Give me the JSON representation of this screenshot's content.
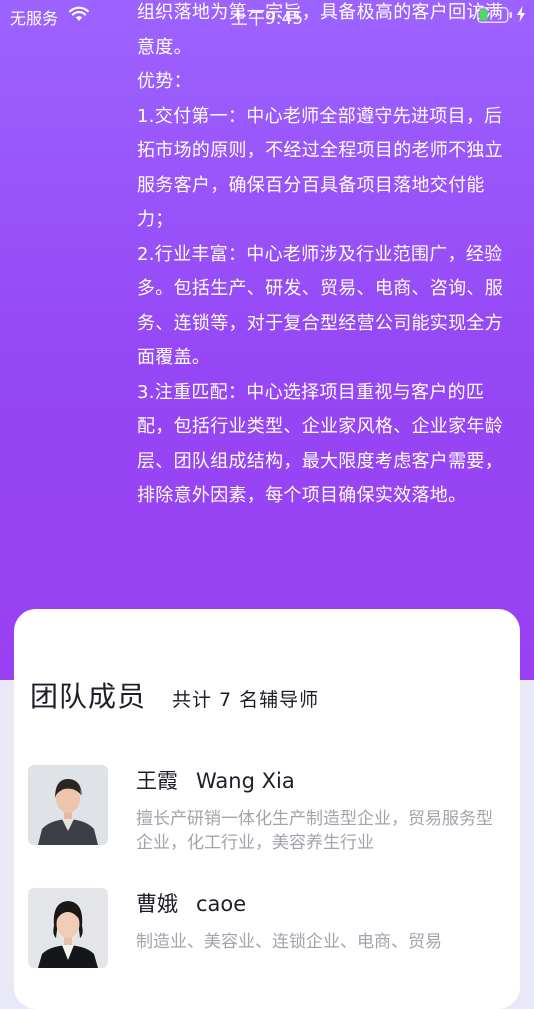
{
  "status_bar": {
    "carrier": "无服务",
    "time": "上午9:45"
  },
  "intro": {
    "paragraphs": [
      "组织落地为第一宗旨，具备极高的客户回访满意度。",
      "优势：",
      "1.交付第一：中心老师全部遵守先进项目，后拓市场的原则，不经过全程项目的老师不独立服务客户，确保百分百具备项目落地交付能力；",
      "2.行业丰富：中心老师涉及行业范围广，经验多。包括生产、研发、贸易、电商、咨询、服务、连锁等，对于复合型经营公司能实现全方面覆盖。",
      "3.注重匹配：中心选择项目重视与客户的匹配，包括行业类型、企业家风格、企业家年龄层、团队组成结构，最大限度考虑客户需要，排除意外因素，每个项目确保实效落地。"
    ]
  },
  "team": {
    "title": "团队成员",
    "count_text": "共计 7 名辅导师",
    "members": [
      {
        "name_cn": "王霞",
        "name_en": "Wang Xia",
        "desc": "擅长产研销一体化生产制造型企业，贸易服务型企业，化工行业，美容养生行业"
      },
      {
        "name_cn": "曹娥",
        "name_en": "caoe",
        "desc": "制造业、美容业、连锁企业、电商、贸易"
      }
    ]
  },
  "colors": {
    "hero_gradient_top": "#9c63ff",
    "hero_gradient_bottom": "#9a40f2",
    "page_background": "#e9e8f7",
    "battery_fill": "#4cd964"
  },
  "icons": [
    "wifi-icon",
    "battery-icon",
    "charging-icon"
  ]
}
